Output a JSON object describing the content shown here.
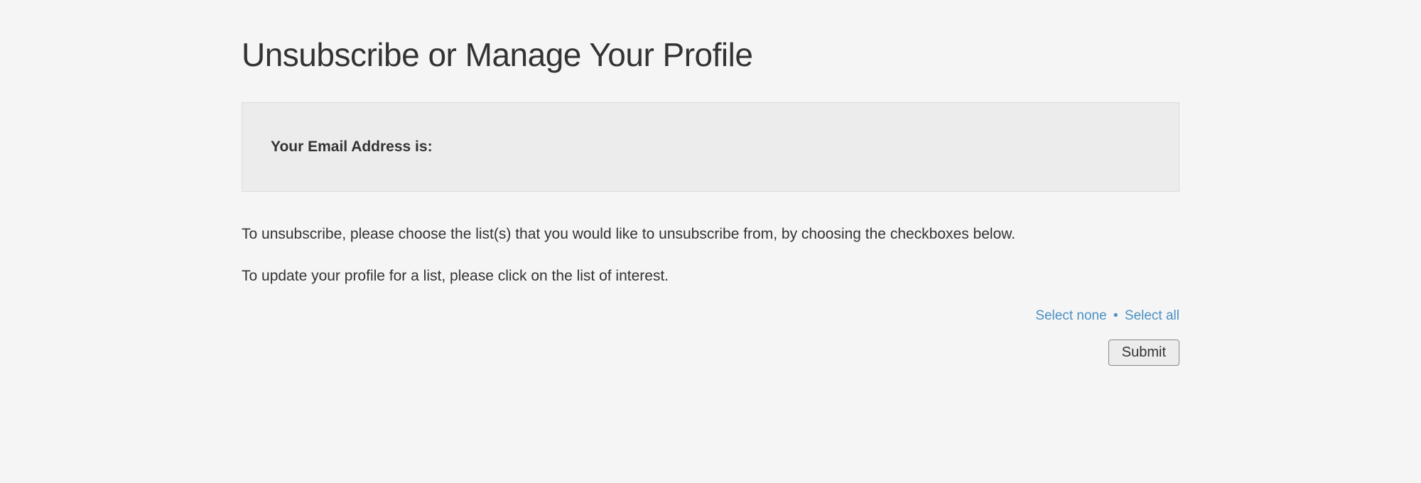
{
  "page": {
    "title": "Unsubscribe or Manage Your Profile"
  },
  "emailBox": {
    "label": "Your Email Address is:"
  },
  "instructions": {
    "line1": "To unsubscribe, please choose the list(s) that you would like to unsubscribe from, by choosing the checkboxes below.",
    "line2": "To update your profile for a list, please click on the list of interest."
  },
  "selectLinks": {
    "none": "Select none",
    "separator": "•",
    "all": "Select all"
  },
  "submit": {
    "label": "Submit"
  }
}
